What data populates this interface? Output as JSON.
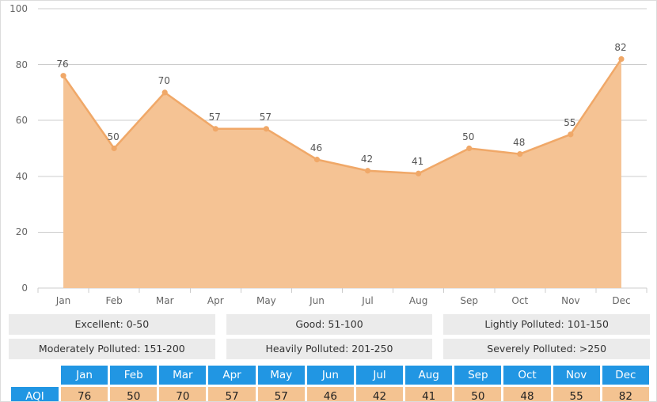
{
  "chart_data": {
    "type": "area",
    "title": "",
    "xlabel": "",
    "ylabel": "",
    "categories": [
      "Jan",
      "Feb",
      "Mar",
      "Apr",
      "May",
      "Jun",
      "Jul",
      "Aug",
      "Sep",
      "Oct",
      "Nov",
      "Dec"
    ],
    "series": [
      {
        "name": "AQI",
        "values": [
          76,
          50,
          70,
          57,
          57,
          46,
          42,
          41,
          50,
          48,
          55,
          82
        ]
      }
    ],
    "values": [
      76,
      50,
      70,
      57,
      57,
      46,
      42,
      41,
      50,
      48,
      55,
      82
    ],
    "ylim": [
      0,
      100
    ],
    "yticks": [
      0,
      20,
      40,
      60,
      80,
      100
    ],
    "ytick_labels": [
      "0",
      "20",
      "40",
      "60",
      "80",
      "100"
    ],
    "grid": true,
    "legend_position": "below-chart",
    "show_point_labels": true,
    "colors": {
      "line": "#f0a868",
      "fill": "#f5c394",
      "marker": "#f0a868",
      "grid": "#cccccc",
      "axis": "#cccccc",
      "tick_text": "#666666",
      "label_text": "#555555",
      "table_header": "#2196e3",
      "table_value": "#f4c391",
      "legend_bg": "#ebebeb"
    }
  },
  "legend": {
    "rows": [
      [
        {
          "label": "Excellent: 0-50"
        },
        {
          "label": "Good: 51-100"
        },
        {
          "label": "Lightly Polluted: 101-150"
        }
      ],
      [
        {
          "label": "Moderately Polluted: 151-200"
        },
        {
          "label": "Heavily Polluted: 201-250"
        },
        {
          "label": "Severely Polluted: >250"
        }
      ]
    ]
  },
  "table": {
    "corner_label": "",
    "row_header": "AQI",
    "columns": [
      "Jan",
      "Feb",
      "Mar",
      "Apr",
      "May",
      "Jun",
      "Jul",
      "Aug",
      "Sep",
      "Oct",
      "Nov",
      "Dec"
    ],
    "values": [
      "76",
      "50",
      "70",
      "57",
      "57",
      "46",
      "42",
      "41",
      "50",
      "48",
      "55",
      "82"
    ]
  }
}
